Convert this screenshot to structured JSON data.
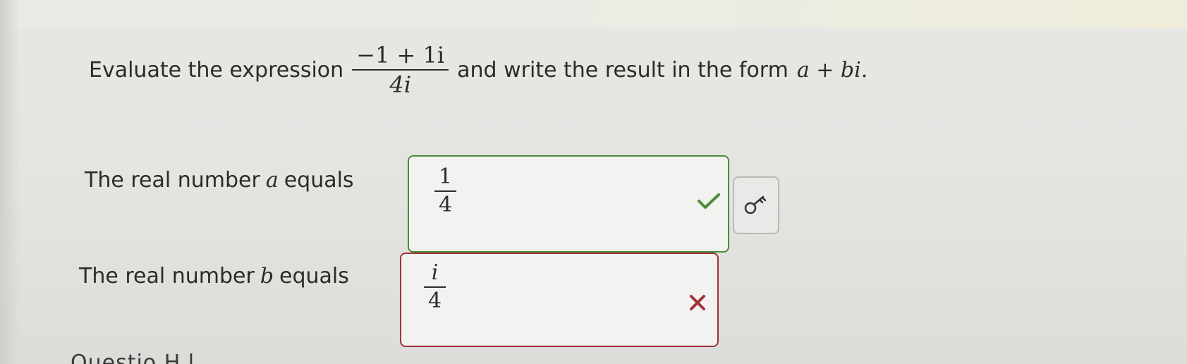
{
  "question": {
    "prefix": "Evaluate the expression",
    "expression": {
      "numerator": "−1 + 1i",
      "denominator": "4i"
    },
    "middle": "and write the result in the form",
    "form": "a + bi",
    "suffix": "."
  },
  "real_a": {
    "label_prefix": "The real number",
    "variable": "a",
    "label_suffix": "equals",
    "answer": {
      "numerator": "1",
      "denominator": "4"
    },
    "status": "correct",
    "status_color": "#4f8a3c"
  },
  "real_b": {
    "label_prefix": "The real number",
    "variable": "b",
    "label_suffix": "equals",
    "answer": {
      "numerator": "i",
      "denominator": "4"
    },
    "status": "incorrect",
    "status_color": "#a0323a"
  },
  "key_button": {
    "icon": "key-icon"
  },
  "footer": {
    "partial_text": "Questio H l"
  }
}
